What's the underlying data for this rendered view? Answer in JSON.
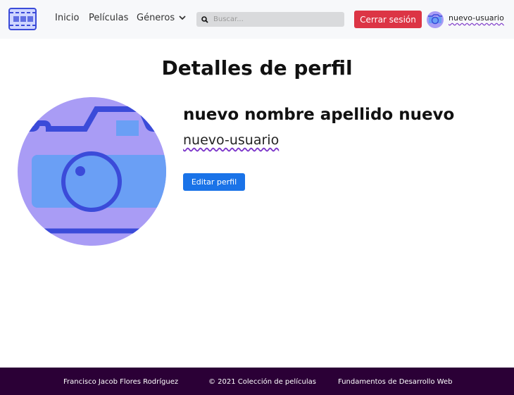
{
  "navbar": {
    "links": [
      "Inicio",
      "Películas",
      "Géneros"
    ],
    "search_placeholder": "Buscar...",
    "logout_label": "Cerrar sesión",
    "username": "nuevo-usuario"
  },
  "profile": {
    "page_title": "Detalles de perfil",
    "full_name": "nuevo nombre apellido nuevo",
    "username": "nuevo-usuario",
    "edit_label": "Editar perfil"
  },
  "footer": {
    "author": "Francisco Jacob Flores Rodríguez",
    "copyright": "© 2021 Colección de películas",
    "course": "Fundamentos de Desarrollo Web"
  },
  "colors": {
    "accent_danger": "#dc3545",
    "accent_primary": "#1a73e8",
    "avatar_bg": "#a99cf5",
    "footer_bg": "#2b0036"
  }
}
